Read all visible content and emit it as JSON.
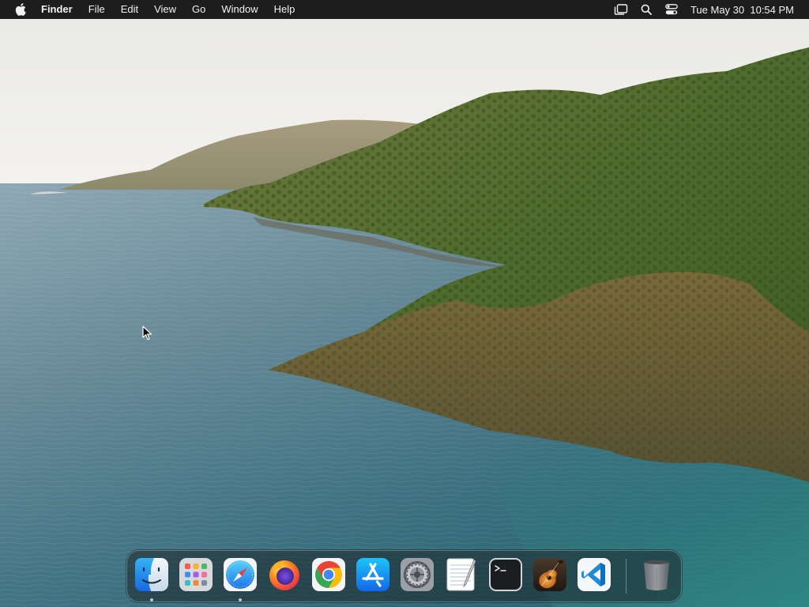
{
  "menubar": {
    "apple_icon": "apple-logo-icon",
    "app_name": "Finder",
    "menus": [
      "File",
      "Edit",
      "View",
      "Go",
      "Window",
      "Help"
    ],
    "status_icons": [
      "stage-manager-icon",
      "search-icon",
      "control-center-icon"
    ],
    "clock": "Tue May 30  10:54 PM"
  },
  "desktop": {
    "wallpaper": "coastal-cliffs-sea-wallpaper"
  },
  "dock": {
    "apps": [
      {
        "name": "Finder",
        "icon": "finder-icon",
        "running": true
      },
      {
        "name": "Launchpad",
        "icon": "launchpad-icon",
        "running": false
      },
      {
        "name": "Safari",
        "icon": "safari-icon",
        "running": true
      },
      {
        "name": "Firefox",
        "icon": "firefox-icon",
        "running": false
      },
      {
        "name": "Google Chrome",
        "icon": "chrome-icon",
        "running": false
      },
      {
        "name": "App Store",
        "icon": "app-store-icon",
        "running": false
      },
      {
        "name": "System Settings",
        "icon": "system-settings-icon",
        "running": false
      },
      {
        "name": "TextEdit",
        "icon": "textedit-icon",
        "running": false
      },
      {
        "name": "Terminal",
        "icon": "terminal-icon",
        "running": false
      },
      {
        "name": "GarageBand",
        "icon": "garageband-icon",
        "running": false
      },
      {
        "name": "Visual Studio Code",
        "icon": "vscode-icon",
        "running": false
      }
    ],
    "trash": {
      "name": "Trash",
      "icon": "trash-icon"
    }
  }
}
